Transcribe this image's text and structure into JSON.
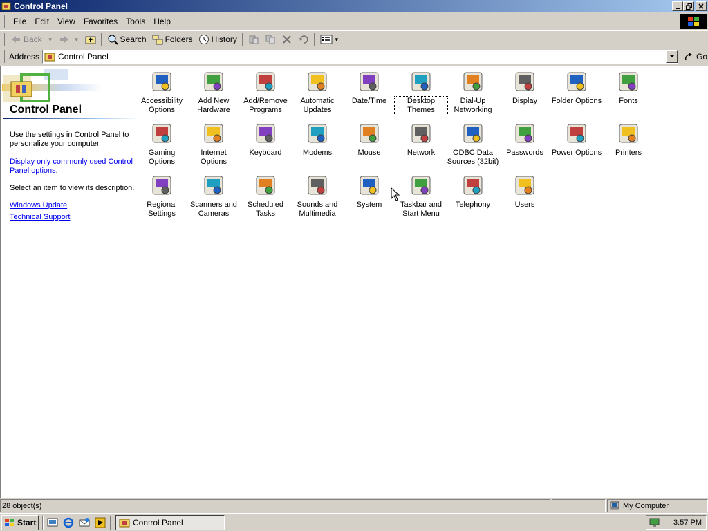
{
  "window": {
    "title": "Control Panel"
  },
  "menubar": {
    "items": [
      {
        "label": "File"
      },
      {
        "label": "Edit"
      },
      {
        "label": "View"
      },
      {
        "label": "Favorites"
      },
      {
        "label": "Tools"
      },
      {
        "label": "Help"
      }
    ]
  },
  "toolbar": {
    "back": "Back",
    "search": "Search",
    "folders": "Folders",
    "history": "History"
  },
  "address": {
    "label": "Address",
    "value": "Control Panel",
    "go": "Go"
  },
  "leftpane": {
    "title": "Control Panel",
    "description": "Use the settings in Control Panel to personalize your computer.",
    "link_common": "Display only commonly used Control Panel options",
    "link_suffix": ".",
    "select_text": "Select an item to view its description.",
    "links": [
      "Windows Update",
      "Technical Support"
    ]
  },
  "items": [
    {
      "label": "Accessibility Options",
      "icon": "accessibility-icon"
    },
    {
      "label": "Add New Hardware",
      "icon": "add-hardware-icon"
    },
    {
      "label": "Add/Remove Programs",
      "icon": "add-remove-programs-icon"
    },
    {
      "label": "Automatic Updates",
      "icon": "automatic-updates-icon"
    },
    {
      "label": "Date/Time",
      "icon": "date-time-icon"
    },
    {
      "label": "Desktop Themes",
      "icon": "desktop-themes-icon"
    },
    {
      "label": "Dial-Up Networking",
      "icon": "dialup-networking-icon"
    },
    {
      "label": "Display",
      "icon": "display-icon"
    },
    {
      "label": "Folder Options",
      "icon": "folder-options-icon"
    },
    {
      "label": "Fonts",
      "icon": "fonts-icon"
    },
    {
      "label": "Gaming Options",
      "icon": "gaming-options-icon"
    },
    {
      "label": "Internet Options",
      "icon": "internet-options-icon"
    },
    {
      "label": "Keyboard",
      "icon": "keyboard-icon"
    },
    {
      "label": "Modems",
      "icon": "modems-icon"
    },
    {
      "label": "Mouse",
      "icon": "mouse-icon"
    },
    {
      "label": "Network",
      "icon": "network-icon"
    },
    {
      "label": "ODBC Data Sources (32bit)",
      "icon": "odbc-icon"
    },
    {
      "label": "Passwords",
      "icon": "passwords-icon"
    },
    {
      "label": "Power Options",
      "icon": "power-options-icon"
    },
    {
      "label": "Printers",
      "icon": "printers-icon"
    },
    {
      "label": "Regional Settings",
      "icon": "regional-settings-icon"
    },
    {
      "label": "Scanners and Cameras",
      "icon": "scanners-cameras-icon"
    },
    {
      "label": "Scheduled Tasks",
      "icon": "scheduled-tasks-icon"
    },
    {
      "label": "Sounds and Multimedia",
      "icon": "sounds-multimedia-icon"
    },
    {
      "label": "System",
      "icon": "system-icon"
    },
    {
      "label": "Taskbar and Start Menu",
      "icon": "taskbar-start-menu-icon"
    },
    {
      "label": "Telephony",
      "icon": "telephony-icon"
    },
    {
      "label": "Users",
      "icon": "users-icon"
    }
  ],
  "selected_item": "Desktop Themes",
  "status": {
    "count": "28 object(s)",
    "zone": "My Computer"
  },
  "taskbar": {
    "start": "Start",
    "task": "Control Panel",
    "time": "3:57 PM"
  },
  "colors": {
    "title_start": "#0a246a",
    "title_end": "#a6caf0",
    "face": "#d4d0c8",
    "link": "#0000ee"
  }
}
